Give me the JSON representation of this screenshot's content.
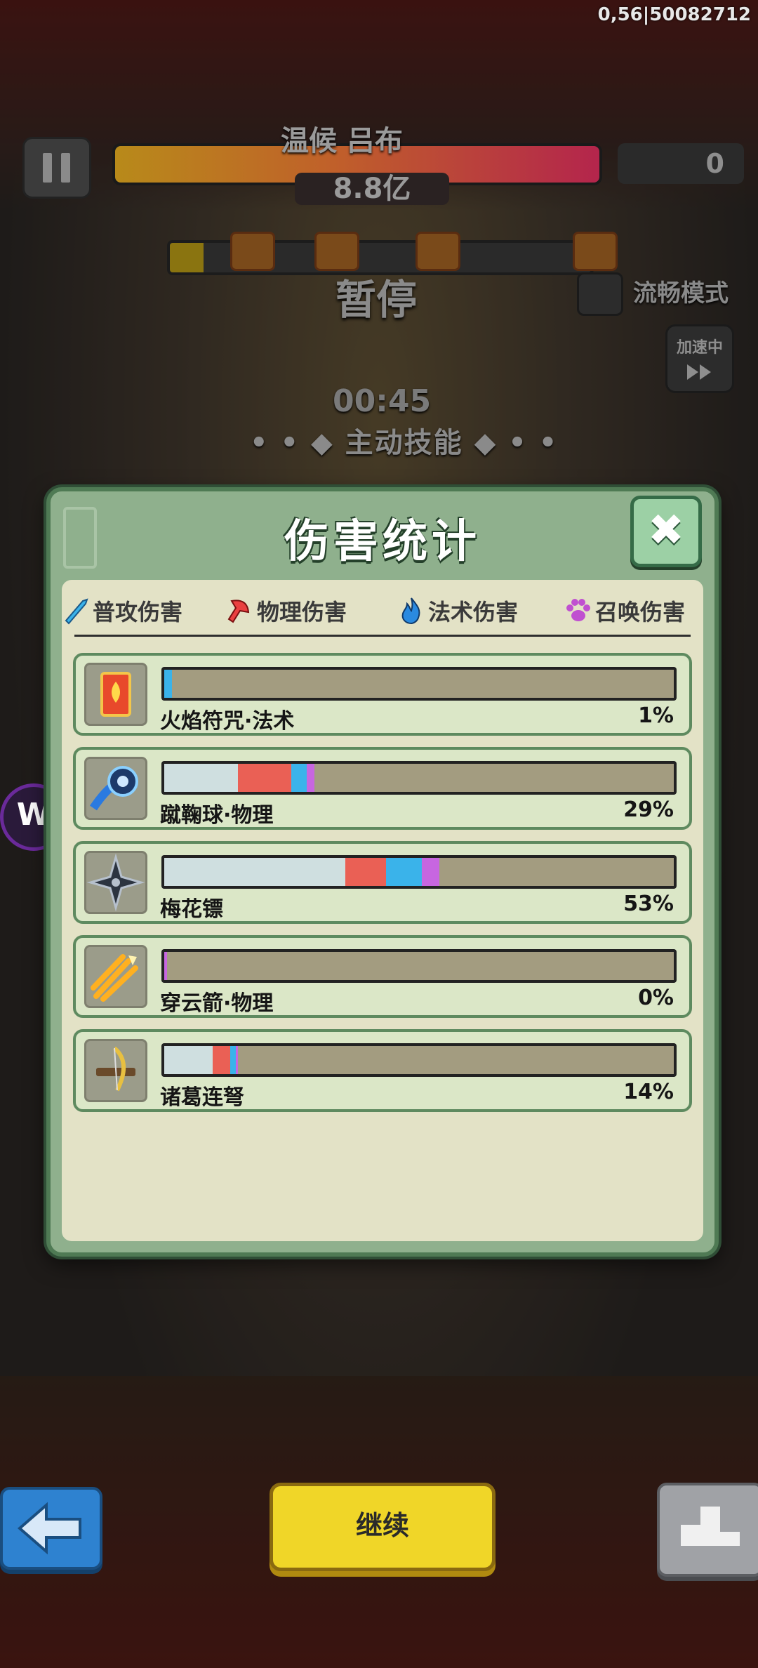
{
  "hud": {
    "version": "0,56|50082712",
    "boss_name": "温候 吕布",
    "boss_hp": "8.8亿",
    "count": "0",
    "paused": "暂停",
    "smooth_mode": "流畅模式",
    "speed_label": "加速中",
    "speed_icon": "fast-forward-icon",
    "timer": "00:45",
    "active_skill": "• • ◆ 主动技能 ◆ • •"
  },
  "modal": {
    "title": "伤害统计",
    "close_icon": "close-icon",
    "legend": [
      {
        "label": "普攻伤害",
        "icon": "sword-icon",
        "color": "#3ab3ea"
      },
      {
        "label": "物理伤害",
        "icon": "axe-icon",
        "color": "#ea4040"
      },
      {
        "label": "法术伤害",
        "icon": "flame-icon",
        "color": "#2a8ae0"
      },
      {
        "label": "召唤伤害",
        "icon": "paw-icon",
        "color": "#c050d0"
      }
    ],
    "rows": [
      {
        "name": "火焰符咒·法术",
        "pct": "1%",
        "icon": "fire-talisman-icon",
        "segments": {
          "normal": 0.0,
          "physical": 0.0,
          "magic": 1.5,
          "summon": 0.0
        }
      },
      {
        "name": "蹴鞠球·物理",
        "pct": "29%",
        "icon": "ball-icon",
        "segments": {
          "normal": 14.5,
          "physical": 10.5,
          "magic": 3.0,
          "summon": 1.5
        }
      },
      {
        "name": "梅花镖",
        "pct": "53%",
        "icon": "shuriken-icon",
        "segments": {
          "normal": 35.5,
          "physical": 8.0,
          "magic": 7.0,
          "summon": 3.5
        }
      },
      {
        "name": "穿云箭·物理",
        "pct": "0%",
        "icon": "arrows-icon",
        "segments": {
          "normal": 0.0,
          "physical": 0.0,
          "magic": 0.0,
          "summon": 0.5
        }
      },
      {
        "name": "诸葛连弩",
        "pct": "14%",
        "icon": "crossbow-icon",
        "segments": {
          "normal": 9.5,
          "physical": 3.5,
          "magic": 1.0,
          "summon": 0.5
        }
      }
    ]
  },
  "buttons": {
    "continue": "继续",
    "back_icon": "arrow-left-icon",
    "rank_icon": "podium-icon",
    "side_badge": "W"
  }
}
